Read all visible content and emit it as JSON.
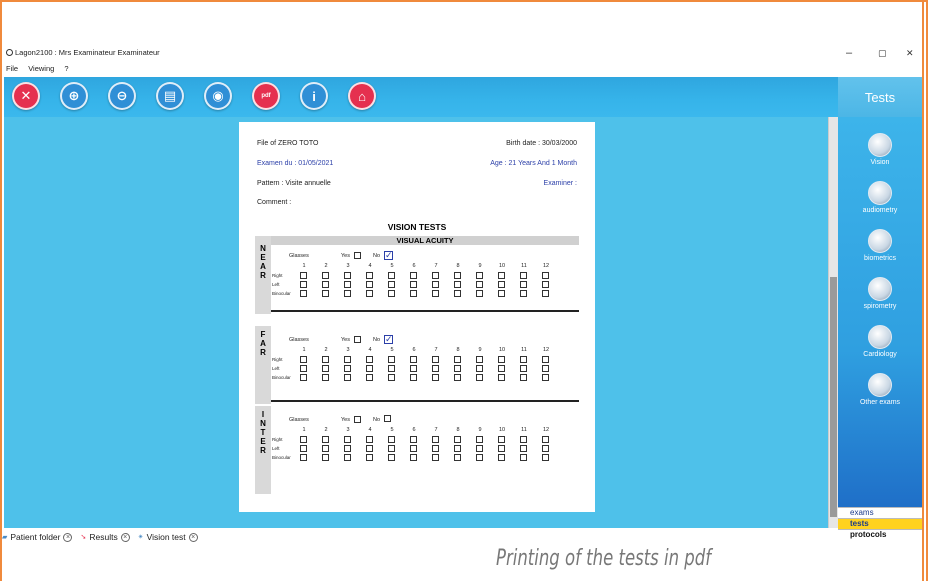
{
  "window": {
    "title": "Lagon2100 : Mrs Examinateur Examinateur",
    "controls": [
      "–",
      "▢",
      "✕"
    ]
  },
  "menu": [
    "File",
    "Viewing",
    "?"
  ],
  "toolbar": {
    "buttons": [
      {
        "name": "close",
        "glyph": "✕",
        "color": "#e5304f"
      },
      {
        "name": "zoom-in",
        "glyph": "⊕",
        "color": "#2f8fd6"
      },
      {
        "name": "zoom-out",
        "glyph": "⊖",
        "color": "#2f8fd6"
      },
      {
        "name": "print",
        "glyph": "▤",
        "color": "#2f8fd6"
      },
      {
        "name": "scan",
        "glyph": "◉",
        "color": "#2f8fd6"
      },
      {
        "name": "pdf",
        "glyph": "pdf",
        "color": "#e5304f"
      },
      {
        "name": "info",
        "glyph": "i",
        "color": "#2f8fd6"
      },
      {
        "name": "home",
        "glyph": "⌂",
        "color": "#e5304f"
      }
    ]
  },
  "side_panel": {
    "header": "Tests",
    "items": [
      "Vision",
      "audiometry",
      "biometrics",
      "spirometry",
      "Cardiology",
      "Other exams"
    ],
    "tabs": [
      {
        "label": "exams",
        "active": false
      },
      {
        "label": "tests",
        "active": true
      },
      {
        "label": "protocols",
        "active": false
      }
    ]
  },
  "document": {
    "file_of": "File of ZERO TOTO",
    "birth_date": "Birth date : 30/03/2000",
    "exam_date": "Examen du : 01/05/2021",
    "age": "Age : 21 Years And 1 Month",
    "pattern": "Pattern : Visite annuelle",
    "examiner": "Examiner :",
    "comment": "Comment :",
    "vision_title": "VISION TESTS",
    "acuity_title": "VISUAL ACUITY",
    "glasses_label": "Glasses",
    "yes_label": "Yes",
    "no_label": "No",
    "row_labels": [
      "Right",
      "Left",
      "Binocular"
    ],
    "columns": [
      "1",
      "2",
      "3",
      "4",
      "5",
      "6",
      "7",
      "8",
      "9",
      "10",
      "11",
      "12"
    ],
    "sections": [
      {
        "label": "NEAR",
        "glasses_yes": false,
        "glasses_no": true
      },
      {
        "label": "FAR",
        "glasses_yes": false,
        "glasses_no": true
      },
      {
        "label": "INTER",
        "glasses_yes": false,
        "glasses_no": false
      }
    ]
  },
  "bottom_tabs": [
    "Patient folder",
    "Results",
    "Vision test"
  ],
  "caption": "Printing of the tests in pdf"
}
